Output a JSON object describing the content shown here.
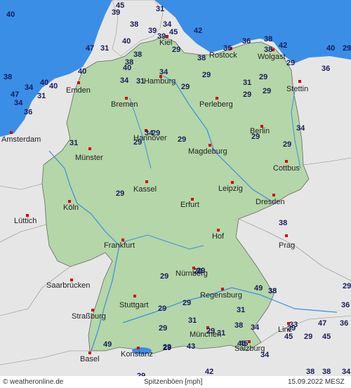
{
  "map": {
    "land_color": "#e6e6e6",
    "water_color": "#3a8ee6",
    "germany_color": "#b4d6a8",
    "city_marker_color": "#d40000",
    "value_color": "#1a1a5e"
  },
  "cities": [
    {
      "name": "Kiel"
    },
    {
      "name": "Rostock"
    },
    {
      "name": "Wolgast"
    },
    {
      "name": "Emden"
    },
    {
      "name": "Hamburg"
    },
    {
      "name": "Stettin"
    },
    {
      "name": "Bremen"
    },
    {
      "name": "Perleberg"
    },
    {
      "name": "Amsterdam"
    },
    {
      "name": "Hannover"
    },
    {
      "name": "Berlin"
    },
    {
      "name": "Münster"
    },
    {
      "name": "Magdeburg"
    },
    {
      "name": "Cottbus"
    },
    {
      "name": "Kassel"
    },
    {
      "name": "Leipzig"
    },
    {
      "name": "Köln"
    },
    {
      "name": "Erfurt"
    },
    {
      "name": "Dresden"
    },
    {
      "name": "Lüttich"
    },
    {
      "name": "Hof"
    },
    {
      "name": "Prag"
    },
    {
      "name": "Frankfurt"
    },
    {
      "name": "Nürnberg"
    },
    {
      "name": "Saarbrücken"
    },
    {
      "name": "Regensburg"
    },
    {
      "name": "Stuttgart"
    },
    {
      "name": "Straßburg"
    },
    {
      "name": "Linz"
    },
    {
      "name": "München"
    },
    {
      "name": "Salzburg"
    },
    {
      "name": "Basel"
    },
    {
      "name": "Konstanz"
    }
  ],
  "gust_values": [
    "40",
    "45",
    "39",
    "31",
    "34",
    "38",
    "39",
    "45",
    "42",
    "39",
    "40",
    "38",
    "38",
    "47",
    "31",
    "29",
    "38",
    "36",
    "36",
    "38",
    "42",
    "40",
    "29",
    "38",
    "40",
    "34",
    "29",
    "40",
    "36",
    "38",
    "40",
    "34",
    "34",
    "31",
    "29",
    "29",
    "47",
    "34",
    "31",
    "40",
    "29",
    "31",
    "29",
    "29",
    "36",
    "34",
    "29",
    "29",
    "31",
    "34",
    "29",
    "29",
    "29",
    "29",
    "29",
    "29",
    "29",
    "38",
    "29",
    "29",
    "38",
    "29",
    "49",
    "38",
    "36",
    "29",
    "29",
    "31",
    "29",
    "31",
    "34",
    "33",
    "38",
    "47",
    "45",
    "29",
    "36",
    "45",
    "31",
    "29",
    "49",
    "29",
    "43",
    "45",
    "45",
    "34",
    "29",
    "38",
    "38",
    "42",
    "34"
  ],
  "footer": {
    "copyright": "© weatheronline.de",
    "legend": "Spitzenböen [mph]",
    "date": "15.09.2022 MESZ"
  }
}
